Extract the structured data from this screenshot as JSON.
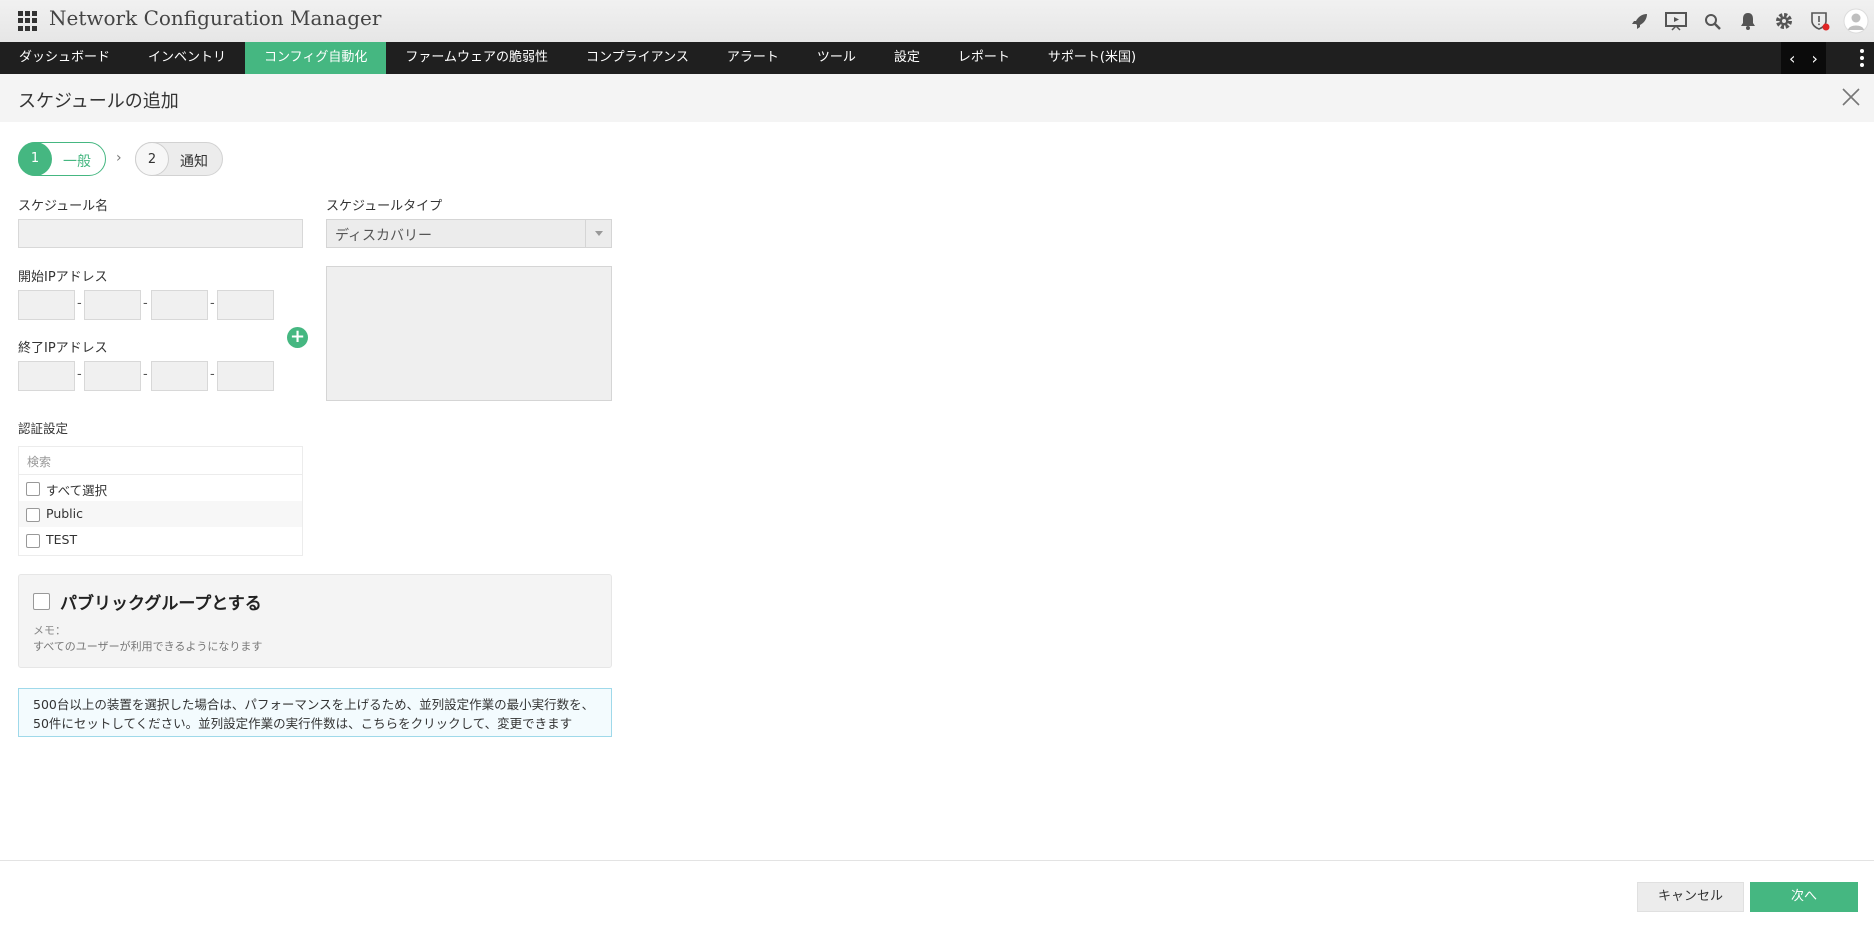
{
  "app": {
    "title": "Network Configuration Manager"
  },
  "nav": {
    "items": [
      "ダッシュボード",
      "インベントリ",
      "コンフィグ自動化",
      "ファームウェアの脆弱性",
      "コンプライアンス",
      "アラート",
      "ツール",
      "設定",
      "レポート",
      "サポート(米国)"
    ],
    "active_index": 2,
    "prev_arrow": "‹",
    "next_arrow": "›"
  },
  "page": {
    "title": "スケジュールの追加"
  },
  "steps": [
    {
      "number": "1",
      "label": "一般"
    },
    {
      "number": "2",
      "label": "通知"
    }
  ],
  "form": {
    "schedule_name_label": "スケジュール名",
    "schedule_type_label": "スケジュールタイプ",
    "schedule_type_value": "ディスカバリー",
    "start_ip_label": "開始IPアドレス",
    "end_ip_label": "終了IPアドレス",
    "ip_separator": "-",
    "add_symbol": "+",
    "cred_label": "認証設定",
    "cred_search_placeholder": "検索",
    "cred_items": [
      "すべて選択",
      "Public",
      "TEST"
    ],
    "public_group_label": "パブリックグループとする",
    "memo_label": "メモ：",
    "memo_text": "すべてのユーザーが利用できるようになります"
  },
  "info": {
    "line1": "500台以上の装置を選択した場合は、パフォーマンスを上げるため、並列設定作業の最小実行数を、",
    "line2": "50件にセットしてください。並列設定作業の実行件数は、こちらをクリックして、変更できます"
  },
  "buttons": {
    "cancel": "キャンセル",
    "next": "次へ"
  },
  "colors": {
    "accent": "#45b781",
    "navbar": "#1f1f1f",
    "alert_dot": "#e02424"
  },
  "icons": [
    "rocket-icon",
    "presentation-icon",
    "search-icon",
    "bell-icon",
    "gear-icon",
    "shield-alert-icon",
    "user-avatar-icon"
  ]
}
